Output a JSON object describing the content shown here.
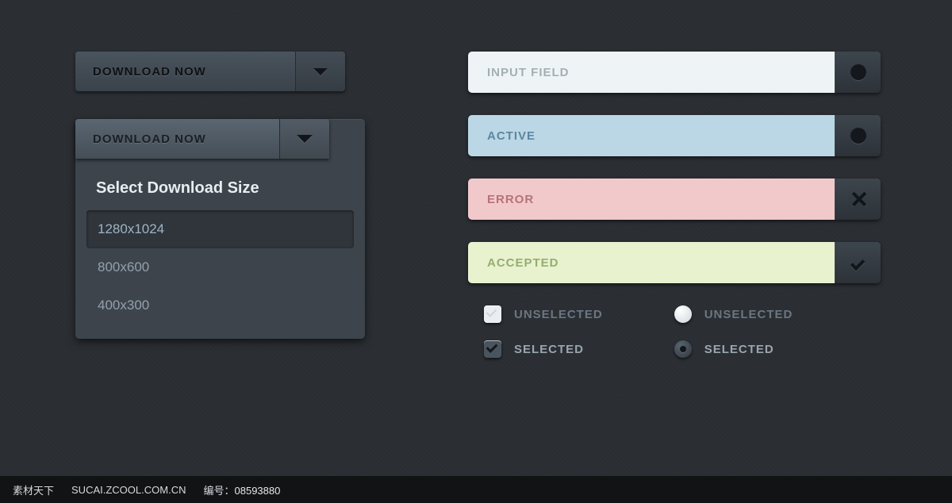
{
  "buttons": {
    "download1": "DOWNLOAD NOW",
    "download2": "DOWNLOAD NOW"
  },
  "dropdown": {
    "header": "Select Download Size",
    "items": [
      "1280x1024",
      "800x600",
      "400x300"
    ],
    "selected_index": 0
  },
  "inputs": {
    "default": "INPUT FIELD",
    "active": "ACTIVE",
    "error": "ERROR",
    "accepted": "ACCEPTED"
  },
  "controls": {
    "checkbox_unselected": "UNSELECTED",
    "checkbox_selected": "SELECTED",
    "radio_unselected": "UNSELECTED",
    "radio_selected": "SELECTED"
  },
  "footer": {
    "site": "素材天下",
    "url": "SUCAI.ZCOOL.COM.CN",
    "id_label": "编号：",
    "id": "08593880"
  }
}
